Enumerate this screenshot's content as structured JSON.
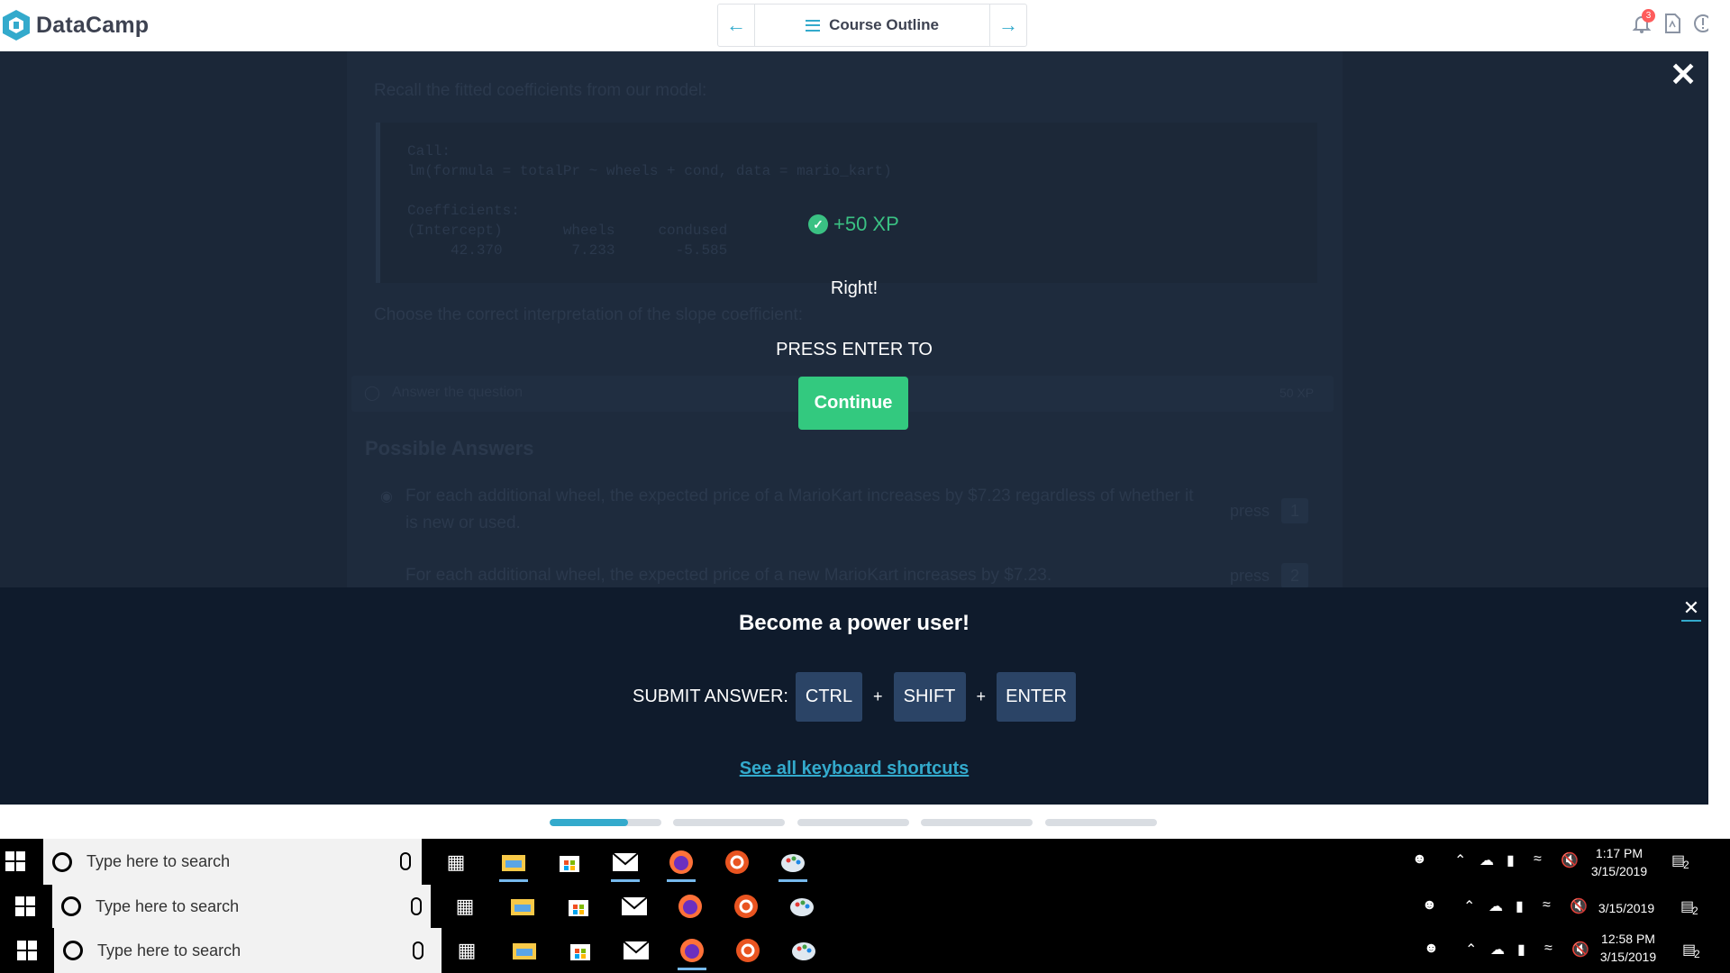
{
  "header": {
    "brand": "DataCamp",
    "nav": {
      "prev_icon": "arrow-left-icon",
      "outline_label": "Course Outline",
      "next_icon": "arrow-right-icon"
    },
    "notification_count": "3",
    "icons": [
      "bell-icon",
      "pdf-icon",
      "info-icon"
    ],
    "accent_color": "#33aacc"
  },
  "background_exercise": {
    "intro": "Recall the fitted coefficients from our model:",
    "code_lines": [
      "Call:",
      "lm(formula = totalPr ~ wheels + cond, data = mario_kart)",
      "",
      "Coefficients:",
      "(Intercept)       wheels     condused",
      "     42.370        7.233       -5.585"
    ],
    "prompt": "Choose the correct interpretation of the slope coefficient:",
    "task_label": "Answer the question",
    "task_xp": "50 XP",
    "possible_answers_title": "Possible Answers",
    "answers": [
      {
        "text_line1": "For each additional wheel, the expected price of a MarioKart increases by $7.23 regardless of whether it",
        "text_line2": "is new or used.",
        "hint": "press",
        "key": "1"
      },
      {
        "text_line1": "For each additional wheel, the expected price of a new MarioKart increases by $7.23.",
        "text_line2": "",
        "hint": "press",
        "key": "2"
      }
    ]
  },
  "success_overlay": {
    "xp_text": "+50 XP",
    "message": "Right!",
    "press_enter": "PRESS ENTER TO",
    "continue_label": "Continue",
    "success_color": "#3ac183",
    "close_icon": "close-icon"
  },
  "power_user": {
    "title": "Become a power user!",
    "submit_label": "SUBMIT ANSWER:",
    "keys": [
      "CTRL",
      "SHIFT",
      "ENTER"
    ],
    "plus": "+",
    "link_text": "See all keyboard shortcuts",
    "close_icon": "close-icon"
  },
  "progress": {
    "segments": 5,
    "first_segment_fill_percent": 70
  },
  "taskbars": [
    {
      "search_placeholder": "Type here to search",
      "time": "1:17 PM",
      "date": "3/15/2019",
      "notification_count": "2"
    },
    {
      "search_placeholder": "Type here to search",
      "time": "",
      "date": "3/15/2019",
      "notification_count": "2"
    },
    {
      "search_placeholder": "Type here to search",
      "time": "12:58 PM",
      "date": "3/15/2019",
      "notification_count": "2"
    }
  ],
  "taskbar_apps": [
    "task-view-icon",
    "file-explorer-icon",
    "store-icon",
    "mail-icon",
    "firefox-icon",
    "ubuntu-icon",
    "paint-icon"
  ]
}
